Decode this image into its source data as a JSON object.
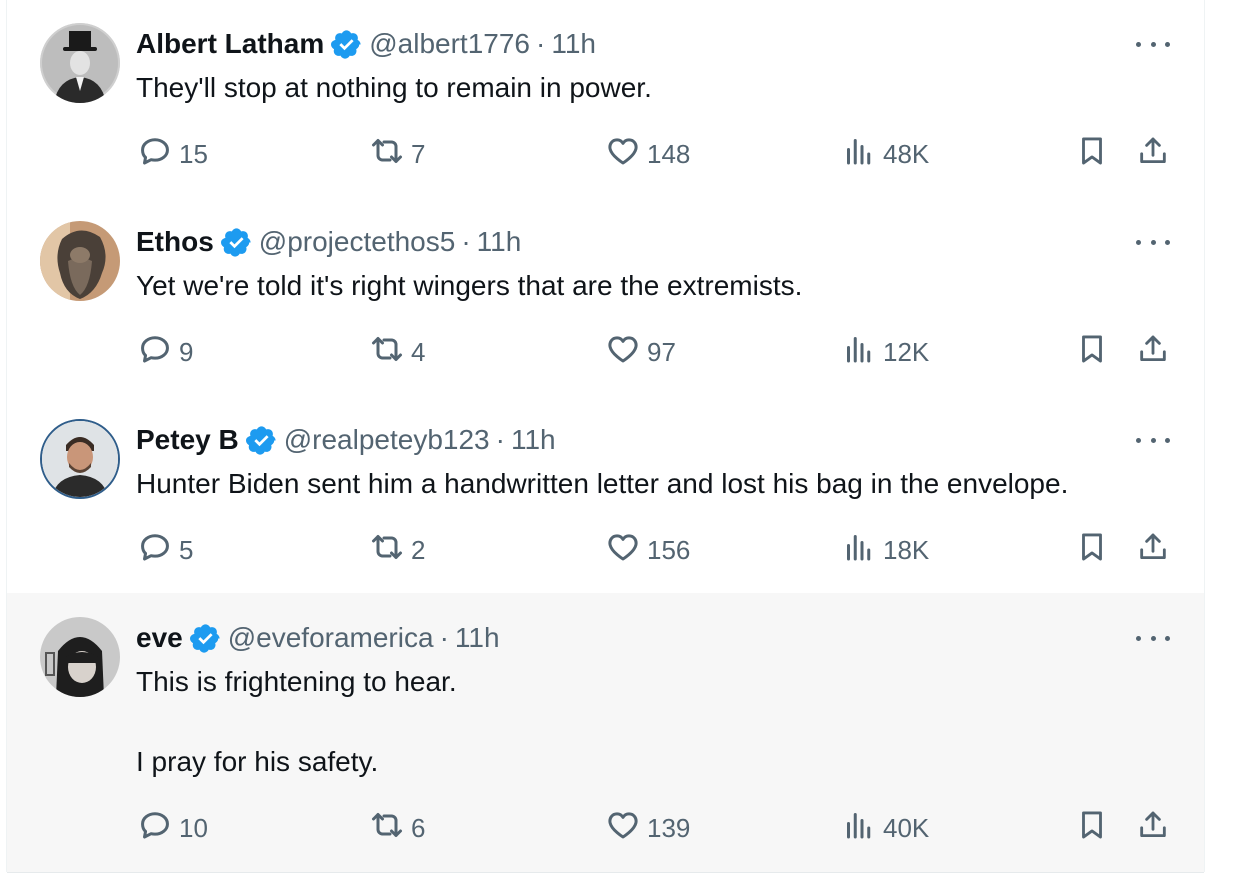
{
  "colors": {
    "verified": "#1d9bf0",
    "text": "#0f1419",
    "secondary": "#536471",
    "highlight_bg": "#f7f7f7"
  },
  "icons": {
    "reply": "speech-bubble-icon",
    "retweet": "retweet-icon",
    "like": "heart-icon",
    "views": "bar-chart-icon",
    "bookmark": "bookmark-icon",
    "share": "share-upload-icon",
    "verified": "verified-badge-icon",
    "more": "more-dots-icon"
  },
  "tweets": [
    {
      "name": "Albert Latham",
      "handle": "@albert1776",
      "separator": "·",
      "time": "11h",
      "text": "They'll stop at nothing to remain in power.",
      "replies": "15",
      "retweets": "7",
      "likes": "148",
      "views": "48K"
    },
    {
      "name": "Ethos",
      "handle": "@projectethos5",
      "separator": "·",
      "time": "11h",
      "text": "Yet we're told it's right wingers that are the extremists.",
      "replies": "9",
      "retweets": "4",
      "likes": "97",
      "views": "12K"
    },
    {
      "name": "Petey B",
      "handle": "@realpeteyb123",
      "separator": "·",
      "time": "11h",
      "text": "Hunter Biden sent him a handwritten letter and lost his bag in the envelope.",
      "replies": "5",
      "retweets": "2",
      "likes": "156",
      "views": "18K"
    },
    {
      "name": "eve",
      "handle": "@eveforamerica",
      "separator": "·",
      "time": "11h",
      "text": "This is frightening to hear.\n\nI pray for his safety.",
      "replies": "10",
      "retweets": "6",
      "likes": "139",
      "views": "40K"
    }
  ]
}
